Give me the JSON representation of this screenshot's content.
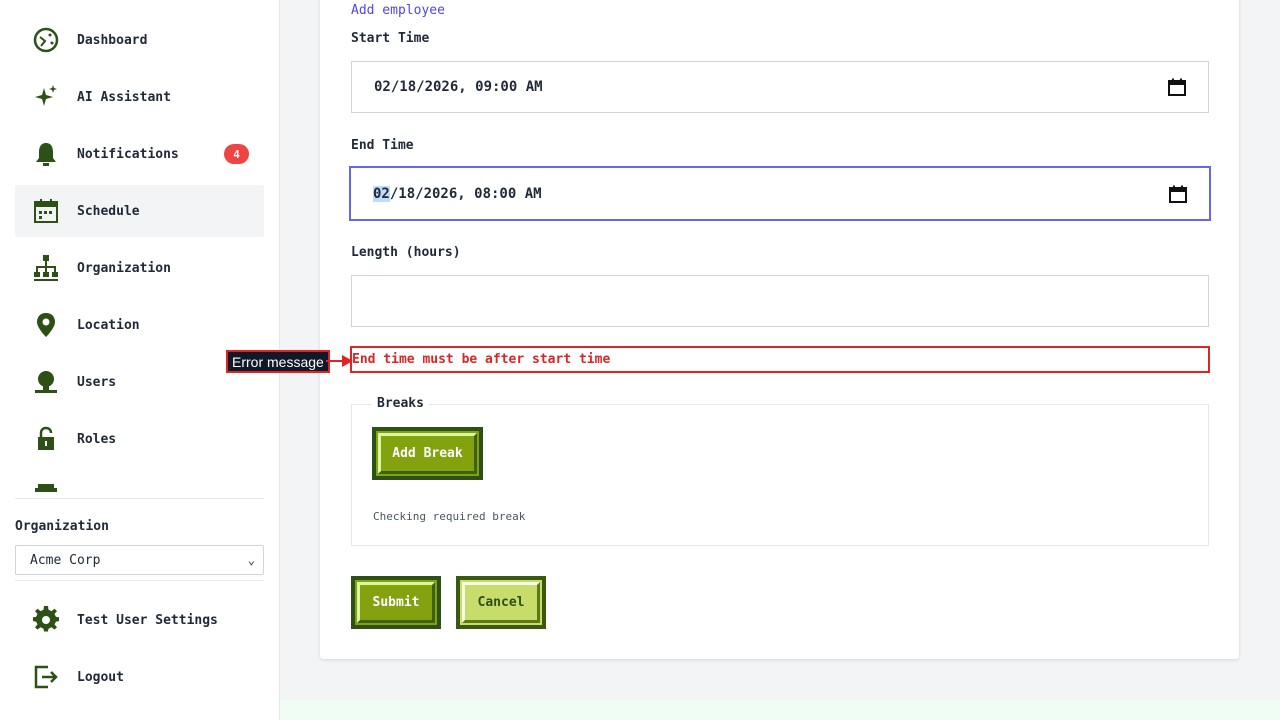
{
  "sidebar": {
    "items": [
      {
        "label": "Dashboard",
        "icon": "dashboard-icon"
      },
      {
        "label": "AI Assistant",
        "icon": "sparkle-icon"
      },
      {
        "label": "Notifications",
        "icon": "bell-icon",
        "badge": "4"
      },
      {
        "label": "Schedule",
        "icon": "calendar-icon",
        "active": true
      },
      {
        "label": "Organization",
        "icon": "org-chart-icon"
      },
      {
        "label": "Location",
        "icon": "location-pin-icon"
      },
      {
        "label": "Users",
        "icon": "user-icon"
      },
      {
        "label": "Roles",
        "icon": "lock-icon"
      }
    ],
    "organization_label": "Organization",
    "organization_selected": "Acme Corp",
    "bottom_items": [
      {
        "label": "Test User Settings",
        "icon": "gear-icon"
      },
      {
        "label": "Logout",
        "icon": "logout-icon"
      }
    ]
  },
  "form": {
    "add_employee_link": "Add employee",
    "start_time_label": "Start Time",
    "start_time_value": "02/18/2026, 09:00 AM",
    "end_time_label": "End Time",
    "end_time_month": "02",
    "end_time_rest": "/18/2026, 08:00 AM",
    "length_label": "Length (hours)",
    "length_value": "",
    "error_message": "End time must be after start time",
    "breaks_legend": "Breaks",
    "add_break_label": "Add Break",
    "break_hint": "Checking required break",
    "submit_label": "Submit",
    "cancel_label": "Cancel"
  },
  "annotation": {
    "label": "Error message"
  },
  "colors": {
    "accent_link": "#4f46e5",
    "focus_border": "#6366f1",
    "error": "#dc2626",
    "badge": "#ef4444",
    "button_green": "#84a10f",
    "button_dark_border": "#2d5016",
    "icon_green": "#2d5016"
  }
}
